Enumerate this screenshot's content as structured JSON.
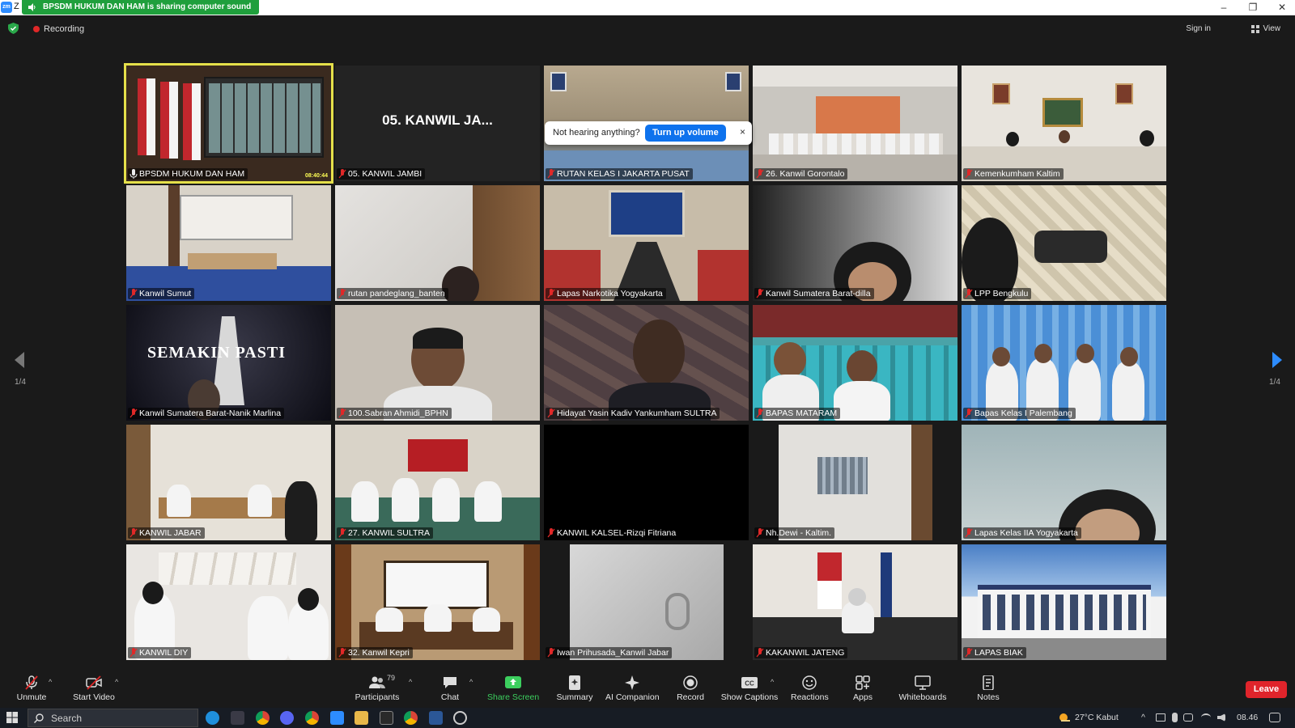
{
  "titlebar": {
    "app_letter": "Z",
    "logo_text": "zm",
    "share_notice": "BPSDM HUKUM DAN HAM is sharing computer sound",
    "controls": [
      "–",
      "❐",
      "✕"
    ]
  },
  "topbar": {
    "recording_label": "Recording",
    "signin_label": "Sign in",
    "view_label": "View"
  },
  "volume_prompt": {
    "text": "Not hearing anything?",
    "button": "Turn up volume",
    "close": "×"
  },
  "gallery": {
    "active_tile_big_name": "05. KANWIL JA...",
    "active_timecode": "08:40:44",
    "tiles": [
      {
        "name": "BPSDM HUKUM DAN HAM"
      },
      {
        "name": "05. KANWIL JAMBI"
      },
      {
        "name": "RUTAN KELAS I JAKARTA PUSAT"
      },
      {
        "name": "26. Kanwil Gorontalo"
      },
      {
        "name": "Kemenkumham Kaltim"
      },
      {
        "name": "Kanwil Sumut"
      },
      {
        "name": "rutan pandeglang_banten"
      },
      {
        "name": "Lapas Narkotika Yogyakarta"
      },
      {
        "name": "Kanwil Sumatera Barat-dilla"
      },
      {
        "name": "LPP Bengkulu"
      },
      {
        "name": "Kanwil Sumatera Barat-Nanik Marlina"
      },
      {
        "name": "100.Sabran Ahmidi_BPHN"
      },
      {
        "name": "Hidayat Yasin Kadiv Yankumham SULTRA"
      },
      {
        "name": "BAPAS MATARAM"
      },
      {
        "name": "Bapas Kelas I Palembang"
      },
      {
        "name": "KANWIL JABAR"
      },
      {
        "name": "27. KANWIL SULTRA"
      },
      {
        "name": "KANWIL KALSEL-Rizqi Fitriana"
      },
      {
        "name": "Nh.Dewi - Kaltim."
      },
      {
        "name": "Lapas Kelas IIA Yogyakarta"
      },
      {
        "name": "KANWIL DIY"
      },
      {
        "name": "32. Kanwil Kepri"
      },
      {
        "name": "Iwan Prihusada_Kanwil Jabar"
      },
      {
        "name": "KAKANWIL JATENG"
      },
      {
        "name": "LAPAS BIAK"
      }
    ],
    "tile3_banner": "SEMAKIN PASTI",
    "page_left": "1/4",
    "page_right": "1/4"
  },
  "toolbar": {
    "unmute": "Unmute",
    "start_video": "Start Video",
    "participants": "Participants",
    "participants_count": "79",
    "chat": "Chat",
    "share_screen": "Share Screen",
    "summary": "Summary",
    "ai_companion": "AI Companion",
    "record": "Record",
    "show_captions": "Show Captions",
    "reactions": "Reactions",
    "apps": "Apps",
    "whiteboards": "Whiteboards",
    "notes": "Notes",
    "leave": "Leave",
    "caret": "^"
  },
  "taskbar": {
    "search_placeholder": "Search",
    "weather": "27°C  Kabut",
    "time": "08.46",
    "tray_caret": "^"
  },
  "colors": {
    "background": "#1a1a1a",
    "share_green": "#1f9f3c",
    "accent_blue": "#0e72ed",
    "leave_red": "#e0242b",
    "active_speaker": "#e5e04a",
    "muted_red": "#e02828"
  }
}
